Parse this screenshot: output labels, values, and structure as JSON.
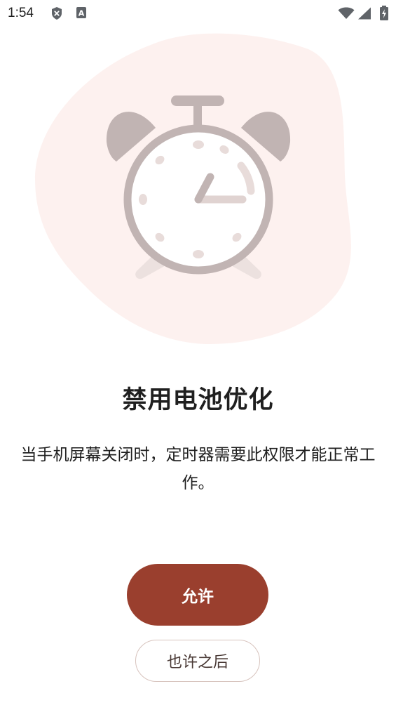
{
  "status_bar": {
    "time": "1:54",
    "icons": [
      "shield-x-icon",
      "a-notification-icon",
      "wifi-icon",
      "cellular-signal-icon",
      "battery-charging-icon"
    ]
  },
  "hero": {
    "illustration": "alarm-clock-icon",
    "blob_color": "#fdf1ef",
    "clock_color": "#c1b4b3"
  },
  "title": "禁用电池优化",
  "description": "当手机屏幕关闭时，定时器需要此权限才能正常工作。",
  "buttons": {
    "allow_label": "允许",
    "later_label": "也许之后"
  },
  "colors": {
    "primary": "#9a3f2e",
    "outline": "#d7c3bd"
  }
}
